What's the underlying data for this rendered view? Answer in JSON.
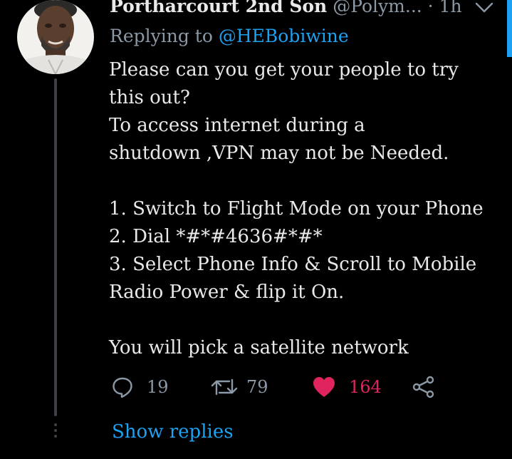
{
  "tweet": {
    "author_name": "Portharcourt 2nd Son",
    "author_handle": "@Polym...",
    "separator": "·",
    "time": "1h",
    "replying_prefix": "Replying to",
    "replying_to": "@HEBobiwine",
    "body_lines": [
      "Please can you get your people to try",
      "this out?",
      "To access internet during a",
      "shutdown ,VPN may not be Needed.",
      "",
      "1. Switch to Flight Mode on your Phone",
      "2. Dial *#*#4636#*#*",
      "3. Select Phone Info & Scroll to Mobile",
      "Radio Power & flip it On.",
      "",
      "You will pick a satellite network"
    ],
    "actions": {
      "reply_count": "19",
      "retweet_count": "79",
      "like_count": "164",
      "liked": true
    },
    "show_replies_label": "Show replies"
  },
  "colors": {
    "background": "#000000",
    "text": "#e9e9e9",
    "muted": "#8b98a5",
    "accent": "#1da1f2",
    "like": "#e0245e"
  },
  "icons": {
    "reply": "comment-bubble-icon",
    "retweet": "retweet-icon",
    "like": "heart-icon",
    "share": "share-icon",
    "menu": "chevron-down-icon"
  }
}
